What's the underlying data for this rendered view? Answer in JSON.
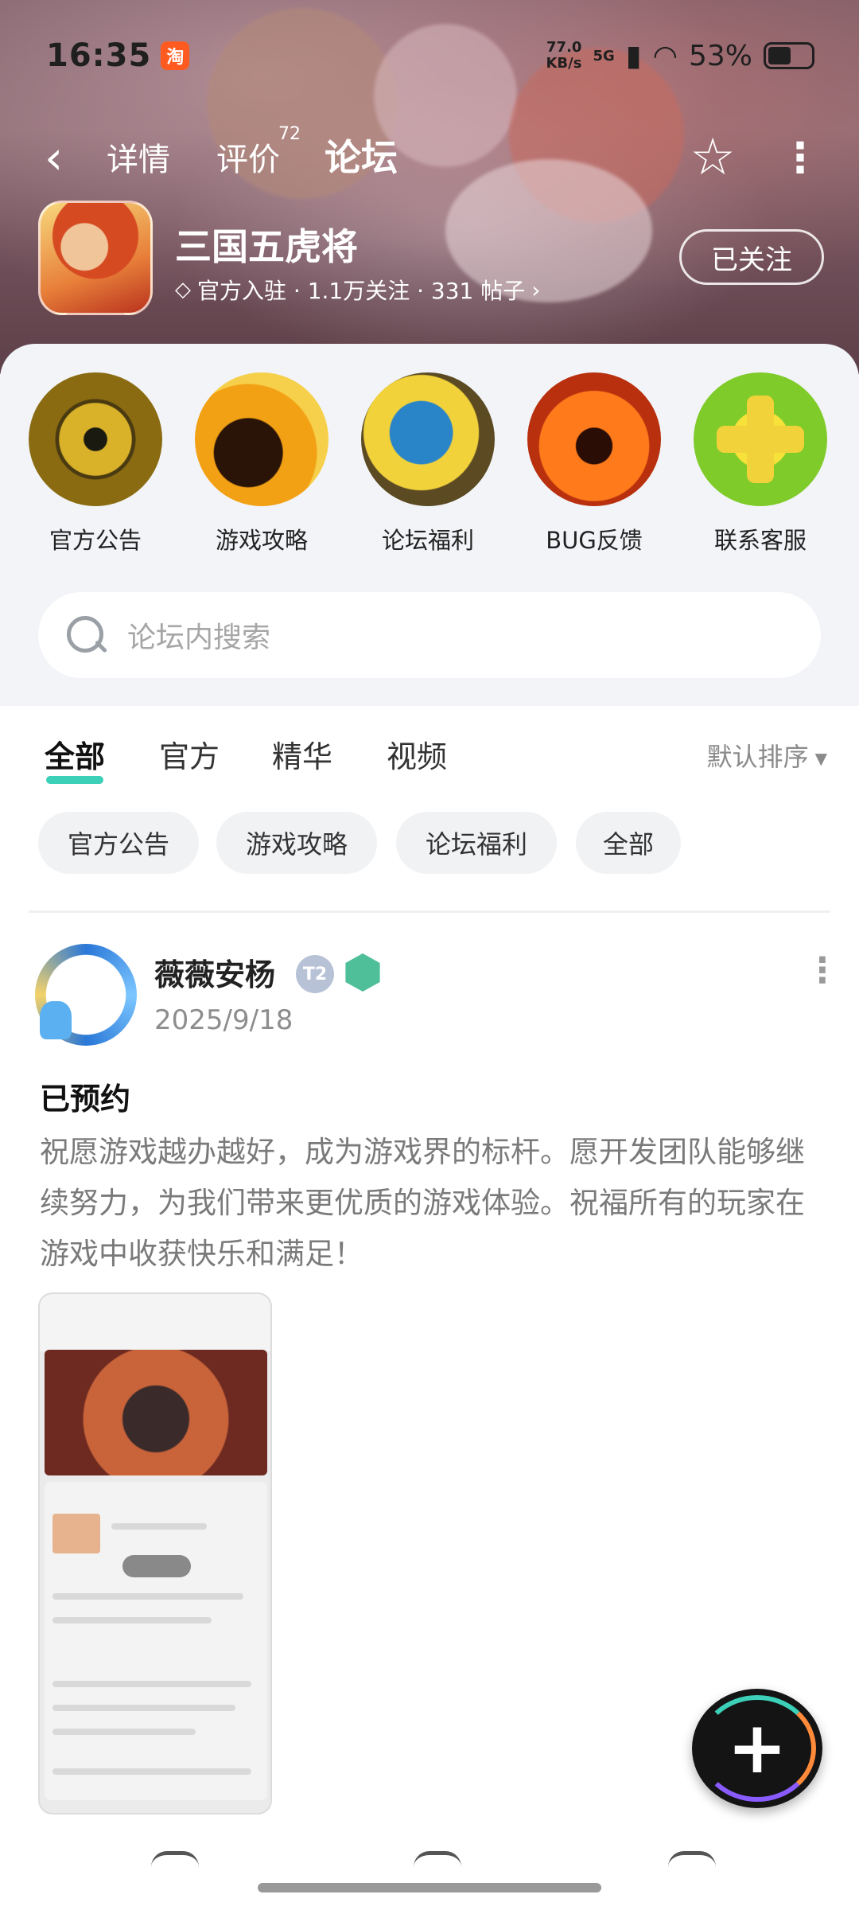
{
  "status_bar": {
    "time": "16:35",
    "app_badge": "淘",
    "net_speed_value": "77.0",
    "net_speed_unit": "KB/s",
    "signal_label": "5G",
    "battery": "53%"
  },
  "nav": {
    "tabs": [
      {
        "label": "详情"
      },
      {
        "label": "评价"
      },
      {
        "label": "论坛"
      }
    ],
    "review_count": "72",
    "active_tab": "论坛",
    "icons": {
      "back": "chevron-left-icon",
      "favorite": "star-icon",
      "more": "more-vertical-icon"
    }
  },
  "game": {
    "title": "三国五虎将",
    "meta": "官方入驻 · 1.1万关注 · 331 帖子",
    "follow_label": "已关注"
  },
  "categories": [
    {
      "label": "官方公告"
    },
    {
      "label": "游戏攻略"
    },
    {
      "label": "论坛福利"
    },
    {
      "label": "BUG反馈"
    },
    {
      "label": "联系客服"
    }
  ],
  "search": {
    "placeholder": "论坛内搜索"
  },
  "filter_tabs": [
    {
      "label": "全部"
    },
    {
      "label": "官方"
    },
    {
      "label": "精华"
    },
    {
      "label": "视频"
    }
  ],
  "sort_label": "默认排序",
  "chips": [
    {
      "label": "官方公告"
    },
    {
      "label": "游戏攻略"
    },
    {
      "label": "论坛福利"
    },
    {
      "label": "全部"
    }
  ],
  "post": {
    "author": "薇薇安杨",
    "badge_level": "2",
    "date": "2025/9/18",
    "title": "已预约",
    "body": "祝愿游戏越办越好，成为游戏界的标杆。愿开发团队能够继续努力，为我们带来更优质的游戏体验。祝福所有的玩家在游戏中收获快乐和满足！"
  },
  "fab": {
    "icon": "plus-icon"
  },
  "colors": {
    "accent": "#3cd0b8",
    "banner": "#7d5e67",
    "panel": "#f2f4f7"
  }
}
